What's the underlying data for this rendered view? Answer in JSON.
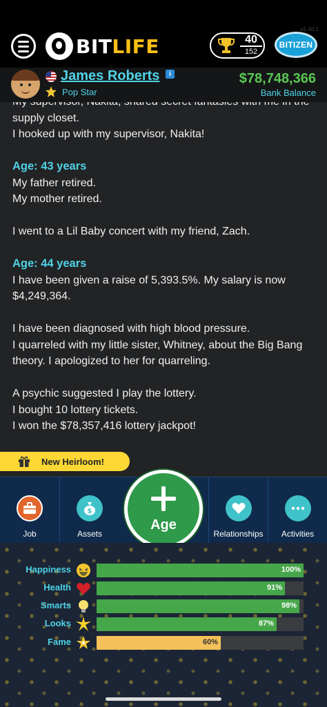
{
  "header": {
    "logo_text_1": "BIT",
    "logo_text_2": "LIFE",
    "version": "v1.40.1",
    "trophies": {
      "earned": "40",
      "total": "152"
    },
    "bitizen_label": "BITIZEN"
  },
  "profile": {
    "name": "James Roberts",
    "occupation": "Pop Star",
    "balance": "$78,748,366",
    "balance_label": "Bank Balance"
  },
  "log": [
    {
      "type": "text",
      "text": "My supervisor, Nakita, shared secret fantasies with me in the supply closet."
    },
    {
      "type": "text",
      "text": "I hooked up with my supervisor, Nakita!"
    },
    {
      "type": "gap"
    },
    {
      "type": "age",
      "text": "Age: 43 years"
    },
    {
      "type": "text",
      "text": "My father retired."
    },
    {
      "type": "text",
      "text": "My mother retired."
    },
    {
      "type": "gap"
    },
    {
      "type": "text",
      "text": "I went to a Lil Baby concert with my friend, Zach."
    },
    {
      "type": "gap"
    },
    {
      "type": "age",
      "text": "Age: 44 years"
    },
    {
      "type": "text",
      "text": "I have been given a raise of 5,393.5%. My salary is now $4,249,364."
    },
    {
      "type": "gap"
    },
    {
      "type": "text",
      "text": "I have been diagnosed with high blood pressure."
    },
    {
      "type": "text",
      "text": "I quarreled with my little sister, Whitney, about the Big Bang theory. I apologized to her for quarreling."
    },
    {
      "type": "gap"
    },
    {
      "type": "text",
      "text": "A psychic suggested I play the lottery."
    },
    {
      "type": "text",
      "text": "I bought 10 lottery tickets."
    },
    {
      "type": "text",
      "text": "I won the $78,357,416 lottery jackpot!"
    }
  ],
  "heirloom_label": "New Heirloom!",
  "nav": {
    "job": "Job",
    "assets": "Assets",
    "age": "Age",
    "relationships": "Relationships",
    "activities": "Activities"
  },
  "stats": [
    {
      "label": "Happiness",
      "value": 100,
      "pct": "100%",
      "color": "#46a64a",
      "icon": "grinning-face-icon"
    },
    {
      "label": "Health",
      "value": 91,
      "pct": "91%",
      "color": "#46a64a",
      "icon": "heart-icon"
    },
    {
      "label": "Smarts",
      "value": 98,
      "pct": "98%",
      "color": "#46a64a",
      "icon": "lightbulb-icon"
    },
    {
      "label": "Looks",
      "value": 87,
      "pct": "87%",
      "color": "#46a64a",
      "icon": "sparkle-icon"
    },
    {
      "label": "Fame",
      "value": 60,
      "pct": "60%",
      "color": "#f4c15a",
      "icon": "fame-star-icon"
    }
  ],
  "colors": {
    "accent_cyan": "#4fd2e6",
    "money_green": "#58c853",
    "nav_blue": "#0f2a4a",
    "age_green": "#2e9a4a",
    "bar_green": "#46a64a",
    "fame_yellow": "#f4c15a"
  }
}
